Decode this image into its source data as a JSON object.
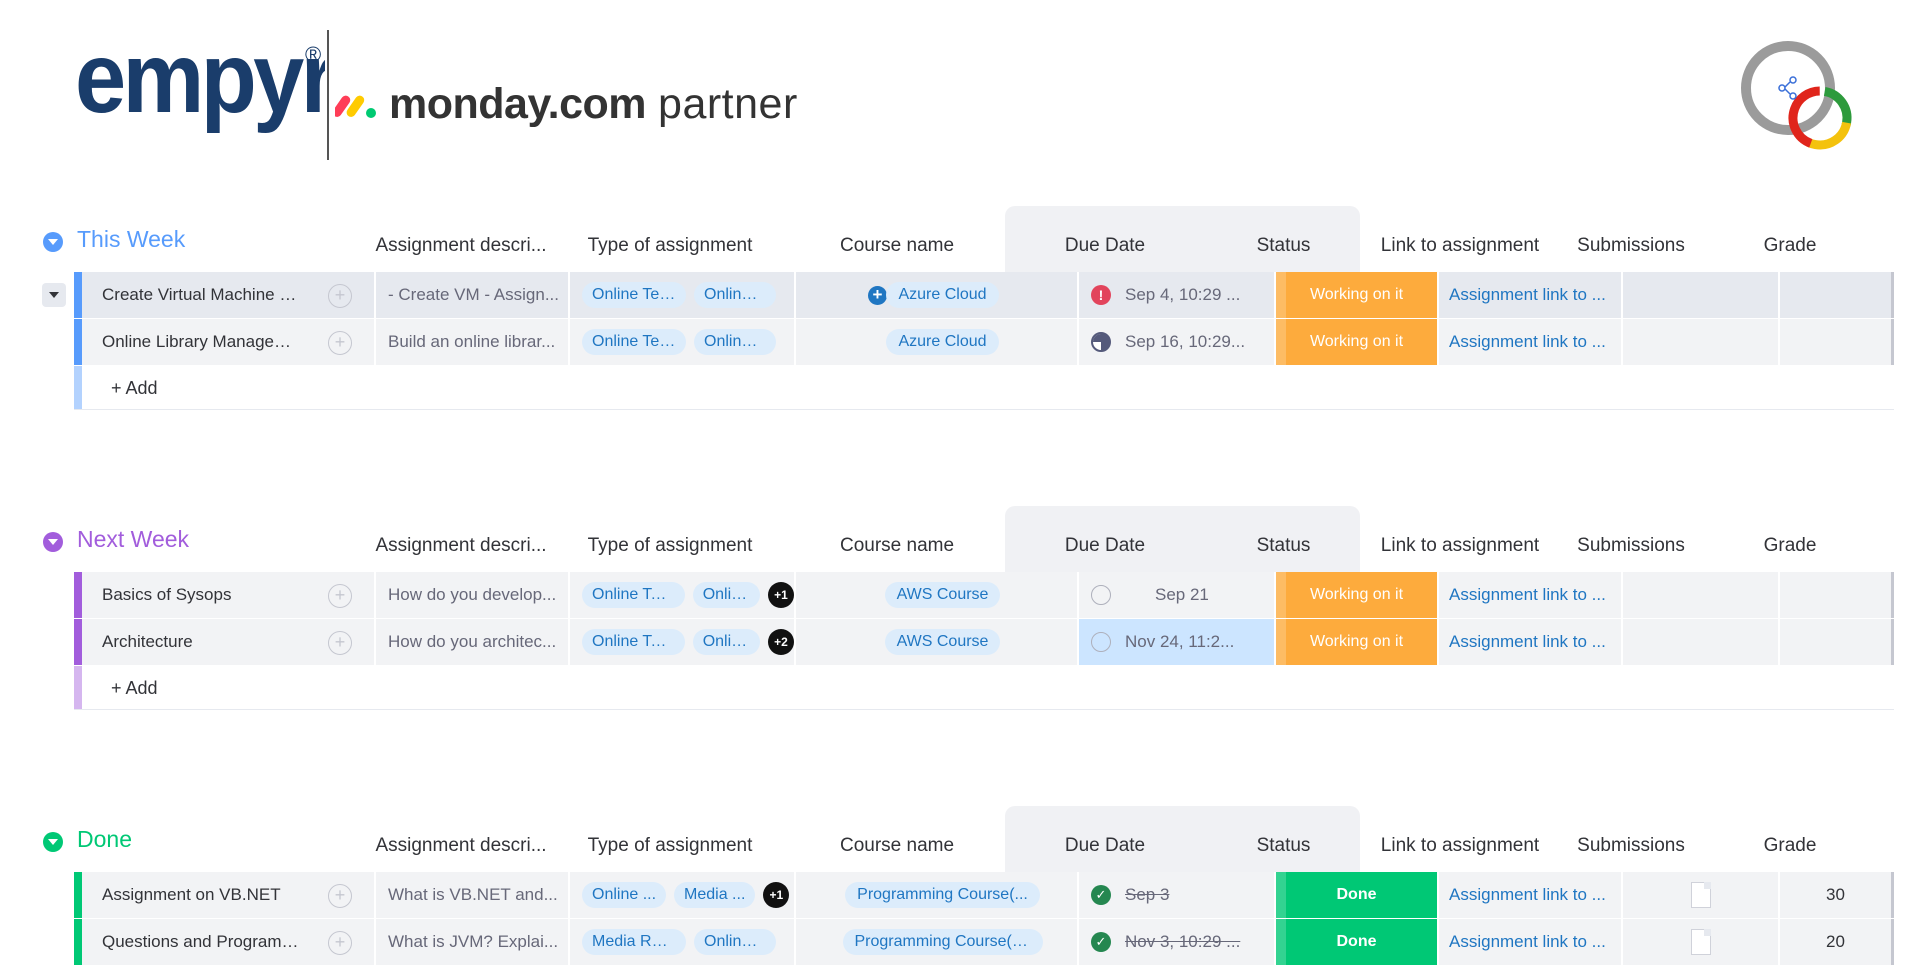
{
  "header": {
    "brand_logo_text": "empyra",
    "registered_mark": "®",
    "partner_brand": "monday.com",
    "partner_word": "partner"
  },
  "columns": {
    "description": "Assignment descri...",
    "type": "Type of assignment",
    "course": "Course name",
    "due": "Due Date",
    "status": "Status",
    "link": "Link to assignment",
    "submissions": "Submissions",
    "grade": "Grade"
  },
  "groups": [
    {
      "title": "This Week",
      "color": "#579bfc",
      "add_label": "+ Add",
      "rows": [
        {
          "name": "Create Virtual Machine a...",
          "description": "- Create VM - Assign...",
          "types": [
            "Online Tex...",
            "Online U..."
          ],
          "more": "",
          "course": "Azure Cloud",
          "due": "Sep 4, 10:29 ...",
          "due_icon": "alert",
          "status": "Working on it",
          "link": "Assignment link to ...",
          "grade": ""
        },
        {
          "name": "Online Library Managem...",
          "description": "Build an online librar...",
          "types": [
            "Online Tex...",
            "Online U..."
          ],
          "more": "",
          "course": "Azure Cloud",
          "due": "Sep 16, 10:29...",
          "due_icon": "half",
          "status": "Working on it",
          "link": "Assignment link to ...",
          "grade": ""
        }
      ]
    },
    {
      "title": "Next Week",
      "color": "#a25ddc",
      "add_label": "+ Add",
      "rows": [
        {
          "name": "Basics of Sysops",
          "description": "How do you develop...",
          "types": [
            "Online Tex...",
            "Onlin..."
          ],
          "more": "+1",
          "course": "AWS Course",
          "due": "Sep 21",
          "due_icon": "empty",
          "status": "Working on it",
          "link": "Assignment link to ...",
          "grade": ""
        },
        {
          "name": "Architecture",
          "description": "How do you architec...",
          "types": [
            "Online Tex...",
            "Onlin..."
          ],
          "more": "+2",
          "course": "AWS Course",
          "due": "Nov 24, 11:2...",
          "due_icon": "empty",
          "status": "Working on it",
          "link": "Assignment link to ...",
          "grade": ""
        }
      ]
    },
    {
      "title": "Done",
      "color": "#00c875",
      "add_label": "",
      "rows": [
        {
          "name": "Assignment on VB.NET",
          "description": "What is VB.NET and...",
          "types": [
            "Online ...",
            "Media ..."
          ],
          "more": "+1",
          "course": "Programming Course(...",
          "due": "Sep 3",
          "due_icon": "done",
          "status": "Done",
          "link": "Assignment link to ...",
          "grade": "30"
        },
        {
          "name": "Questions and Programs...",
          "description": "What is JVM? Explai...",
          "types": [
            "Media Rec...",
            "Online U..."
          ],
          "more": "",
          "course": "Programming Course(J...",
          "due": "Nov 3, 10:29 ...",
          "due_icon": "done",
          "status": "Done",
          "link": "Assignment link to ...",
          "grade": "20"
        }
      ]
    }
  ],
  "colors": {
    "working": "#fdab3d",
    "done": "#00c875",
    "link": "#1f76c2",
    "empyra_blue": "#1a3d6b"
  }
}
